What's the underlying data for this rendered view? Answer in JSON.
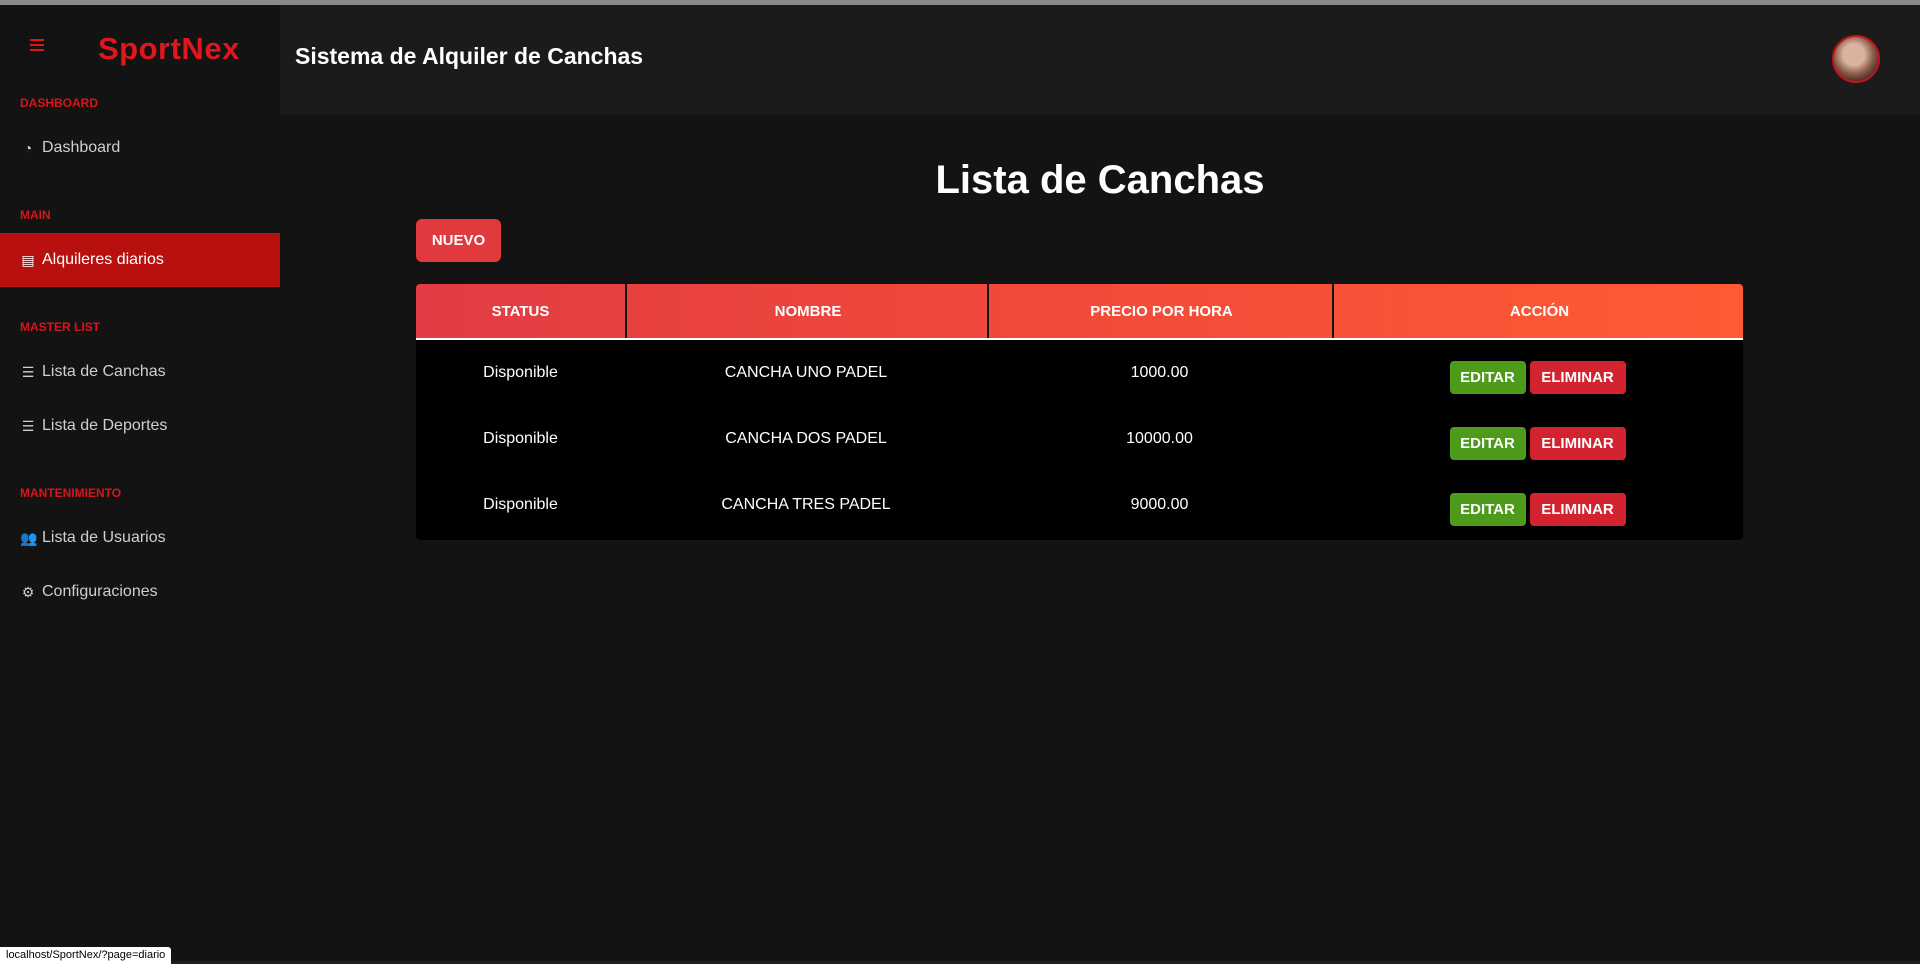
{
  "app": {
    "brand": "SportNex",
    "header_title": "Sistema de Alquiler de Canchas"
  },
  "sidebar": {
    "sections": {
      "dashboard": "DASHBOARD",
      "main": "MAIN",
      "master": "MASTER LIST",
      "maintenance": "MANTENIMIENTO"
    },
    "items": [
      {
        "label": "Dashboard",
        "icon": "gauge-icon"
      },
      {
        "label": "Alquileres diarios",
        "icon": "file-icon",
        "active": true
      },
      {
        "label": "Lista de Canchas",
        "icon": "list-icon"
      },
      {
        "label": "Lista de Deportes",
        "icon": "list-icon"
      },
      {
        "label": "Lista de Usuarios",
        "icon": "users-icon"
      },
      {
        "label": "Configuraciones",
        "icon": "gear-icon"
      }
    ]
  },
  "main": {
    "title": "Lista de Canchas",
    "new_button": "NUEVO",
    "table": {
      "headers": [
        "STATUS",
        "NOMBRE",
        "PRECIO POR HORA",
        "ACCIÓN"
      ],
      "rows": [
        {
          "status": "Disponible",
          "nombre": "CANCHA UNO PADEL",
          "precio": "1000.00"
        },
        {
          "status": "Disponible",
          "nombre": "CANCHA DOS PADEL",
          "precio": "10000.00"
        },
        {
          "status": "Disponible",
          "nombre": "CANCHA TRES PADEL",
          "precio": "9000.00"
        }
      ],
      "edit_label": "EDITAR",
      "delete_label": "ELIMINAR"
    }
  },
  "status_bar": {
    "url": "localhost/SportNex/?page=diario"
  },
  "colors": {
    "accent": "#e0161d",
    "active_bg": "#b80f0f",
    "edit": "#4e9a1b",
    "delete": "#d3232f"
  }
}
